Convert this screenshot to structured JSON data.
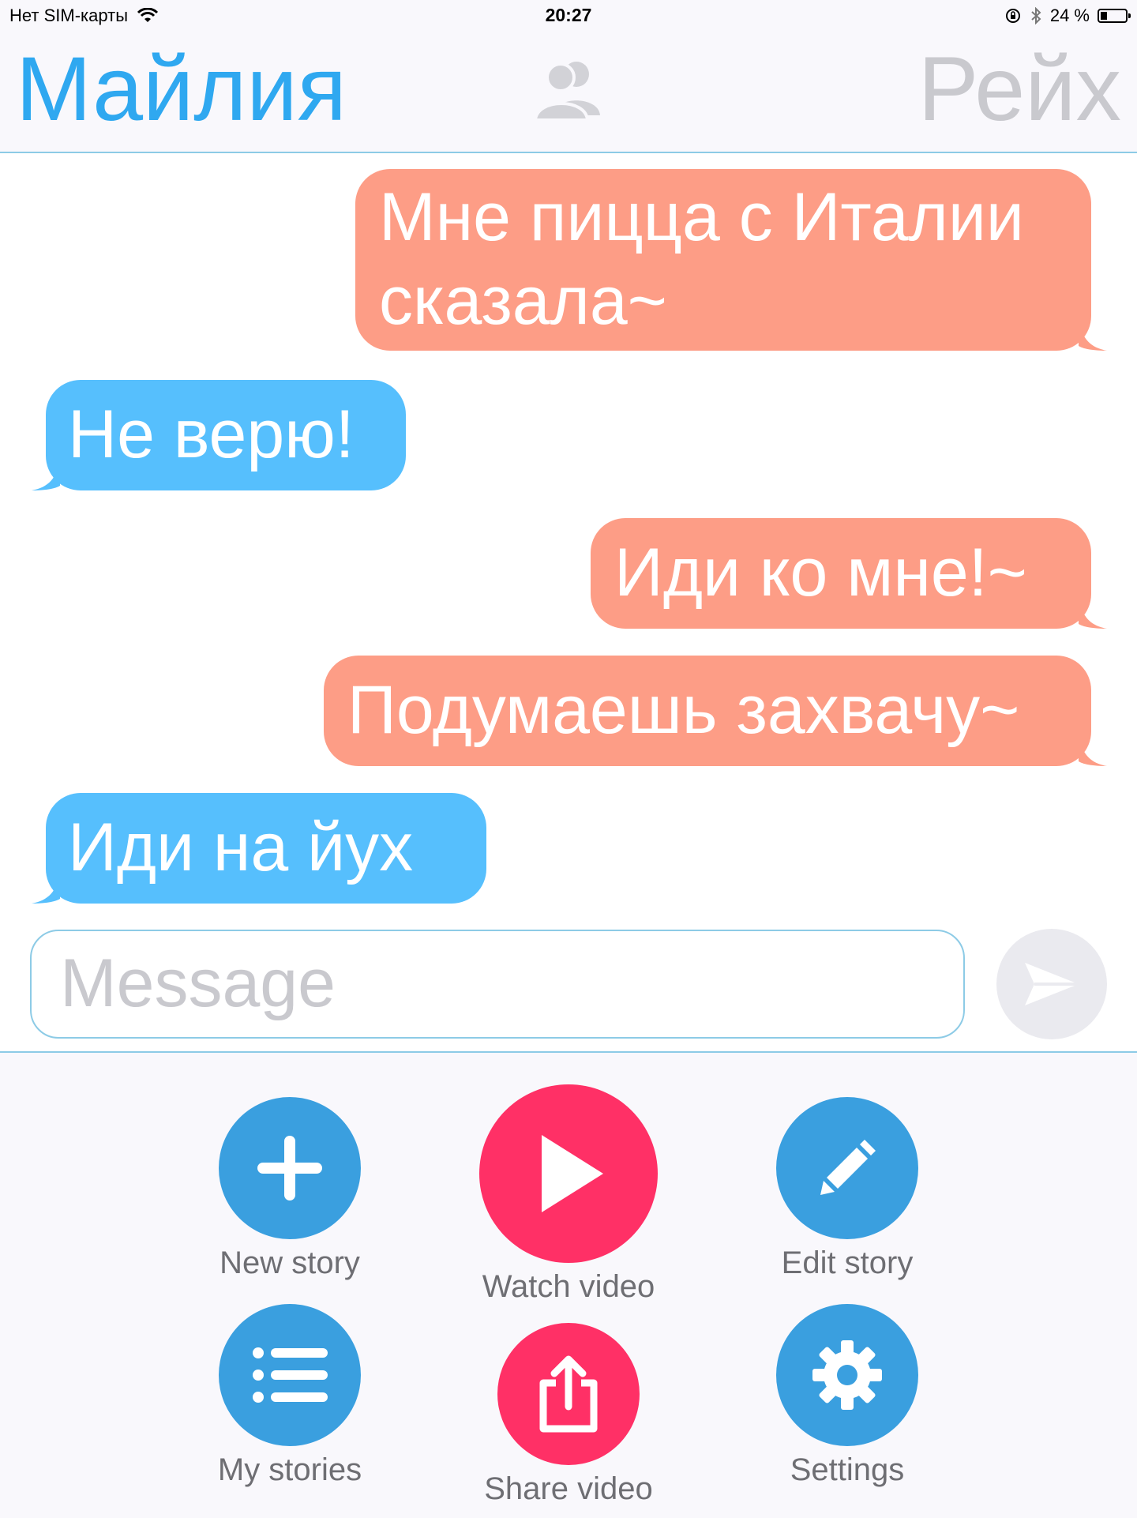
{
  "status_bar": {
    "carrier": "Нет SIM-карты",
    "time": "20:27",
    "battery": "24 %"
  },
  "header": {
    "left_name": "Майлия",
    "right_name": "Рейх"
  },
  "messages": [
    {
      "text_line1": "Мне пицца с Италии",
      "text_line2": "сказала~",
      "direction": "outgoing"
    },
    {
      "text": "Не верю!",
      "direction": "incoming"
    },
    {
      "text": "Иди ко мне!~",
      "direction": "outgoing"
    },
    {
      "text": "Подумаешь захвачу~",
      "direction": "outgoing"
    },
    {
      "text": "Иди на йух",
      "direction": "incoming"
    }
  ],
  "composer": {
    "placeholder": "Message"
  },
  "actions": [
    {
      "label": "New story",
      "icon": "plus-icon",
      "color": "#3a9fdf"
    },
    {
      "label": "Watch video",
      "icon": "play-icon",
      "color": "#ff3066"
    },
    {
      "label": "Edit story",
      "icon": "pencil-icon",
      "color": "#3a9fdf"
    },
    {
      "label": "My stories",
      "icon": "list-icon",
      "color": "#3a9fdf"
    },
    {
      "label": "Share video",
      "icon": "share-icon",
      "color": "#ff3066"
    },
    {
      "label": "Settings",
      "icon": "gear-icon",
      "color": "#3a9fdf"
    }
  ],
  "colors": {
    "accent": "#2fa8f0",
    "outgoing_bubble": "#fd9d86",
    "incoming_bubble": "#56bffd",
    "video_red": "#ff3066",
    "divider": "#8dcbe6"
  }
}
